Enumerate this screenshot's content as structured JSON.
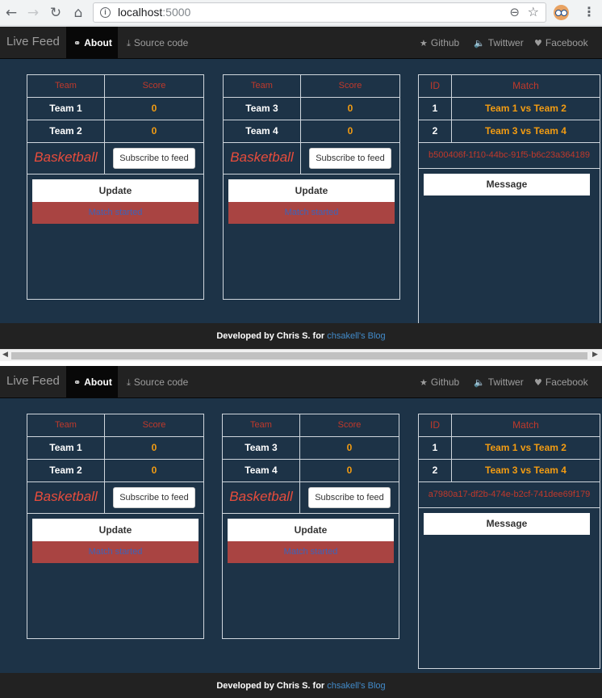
{
  "browser": {
    "url_host": "localhost",
    "url_port": ":5000",
    "back_icon": "←",
    "forward_icon": "→",
    "reload_icon": "↻",
    "home_icon": "⌂",
    "info_icon": "i",
    "zoom_icon": "⊖",
    "star_icon": "☆",
    "menu_icon": "⋮"
  },
  "navbar": {
    "brand": "Live Feed",
    "about": "About",
    "about_icon": "⚭",
    "source": "Source code",
    "source_icon": "⤓",
    "github": "Github",
    "github_icon": "★",
    "twitter": "Twittwer",
    "twitter_icon": "🔈",
    "facebook": "Facebook",
    "facebook_icon": "♥"
  },
  "headers": {
    "team": "Team",
    "score": "Score",
    "id": "ID",
    "match": "Match"
  },
  "boards": [
    {
      "team1": "Team 1",
      "score1": "0",
      "team2": "Team 2",
      "score2": "0",
      "sport": "Basketball",
      "subscribe": "Subscribe to feed",
      "update": "Update",
      "status": "Match started"
    },
    {
      "team1": "Team 3",
      "score1": "0",
      "team2": "Team 4",
      "score2": "0",
      "sport": "Basketball",
      "subscribe": "Subscribe to feed",
      "update": "Update",
      "status": "Match started"
    }
  ],
  "matches": [
    {
      "id": "1",
      "match": "Team 1 vs Team 2"
    },
    {
      "id": "2",
      "match": "Team 3 vs Team 4"
    }
  ],
  "panes": [
    {
      "connection_id": "b500406f-1f10-44bc-91f5-b6c23a364189"
    },
    {
      "connection_id": "a7980a17-df2b-474e-b2cf-741dee69f179"
    }
  ],
  "message_button": "Message",
  "footer": {
    "text": "Developed by Chris S. for ",
    "link": "chsakell's Blog"
  },
  "scrollbar": {
    "left_arrow": "◀",
    "right_arrow": "▶"
  }
}
